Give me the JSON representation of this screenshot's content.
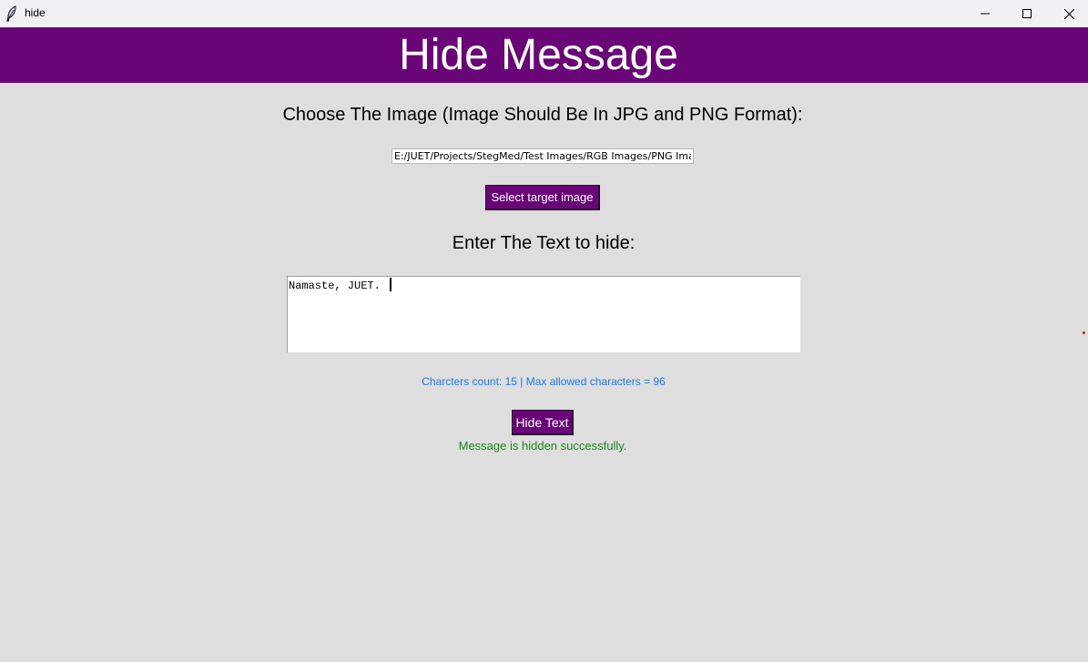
{
  "window": {
    "title": "hide",
    "icon": "feather-icon",
    "controls": [
      "minimize-icon",
      "maximize-icon",
      "close-icon"
    ]
  },
  "header": {
    "title": "Hide Message",
    "background_color": "#6a0578"
  },
  "image_section": {
    "label": "Choose The Image (Image Should Be In JPG and PNG Format):",
    "path_value": "E:/JUET/Projects/StegMed/Test Images/RGB Images/PNG Images",
    "select_button_label": "Select target image"
  },
  "text_section": {
    "label": "Enter The Text to hide:",
    "text_value": "Namaste, JUET.",
    "char_count_text": "Charcters count: 15 | Max allowed characters = 96"
  },
  "actions": {
    "hide_button_label": "Hide Text"
  },
  "status": {
    "message": "Message is hidden successfully.",
    "color": "#1a8a1a"
  },
  "colors": {
    "accent": "#6a0578",
    "background": "#dedede",
    "info_text": "#1e7be8"
  }
}
